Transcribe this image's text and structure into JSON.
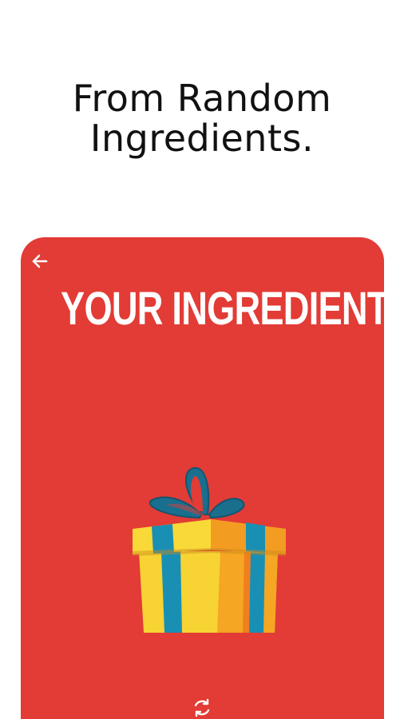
{
  "headline": {
    "line1": "From Random",
    "line2": "Ingredients."
  },
  "card": {
    "title": "YOUR INGREDIENTS",
    "background_color": "#e33b35",
    "back_icon": "arrow-left-icon",
    "illustration": "gift-box-icon",
    "refresh_icon": "refresh-icon"
  }
}
